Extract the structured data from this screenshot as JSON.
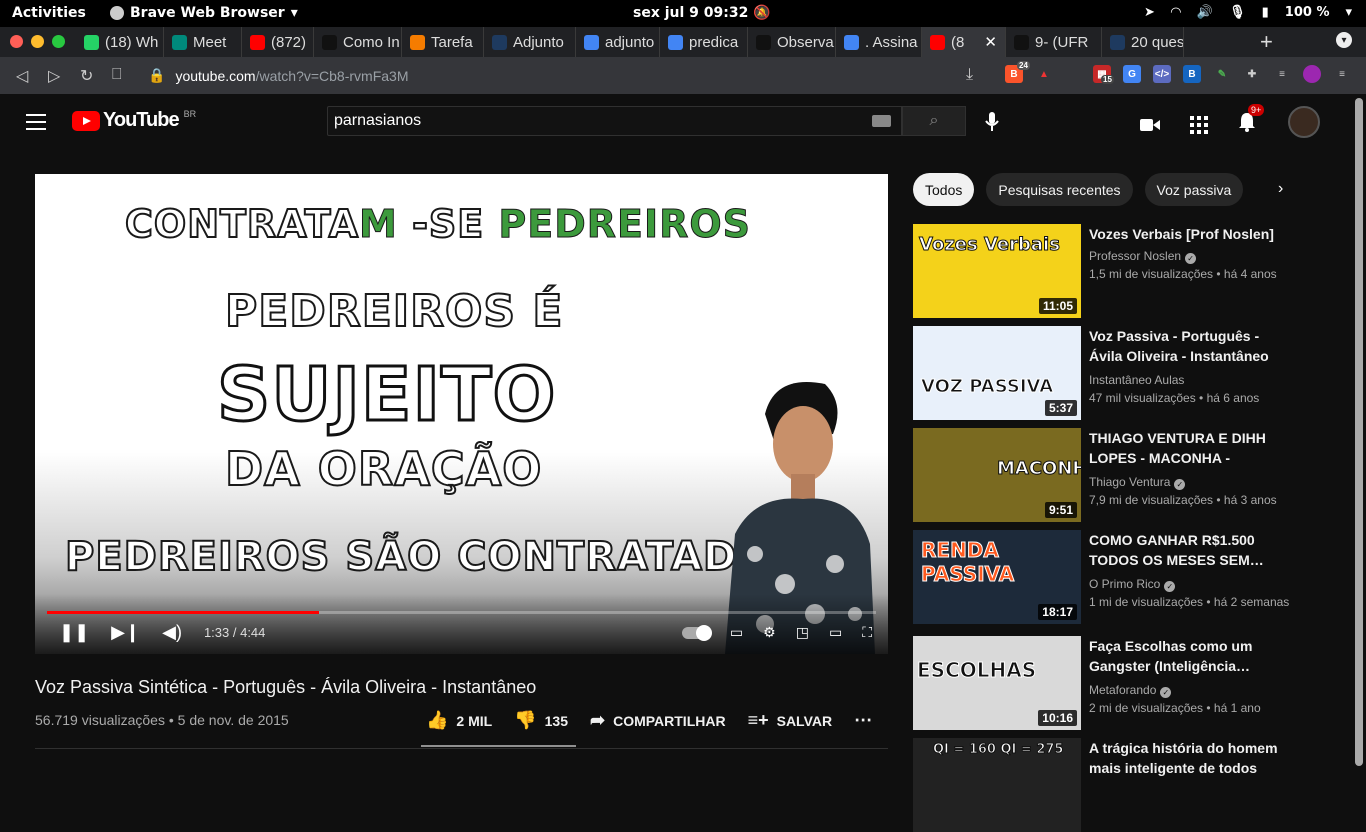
{
  "system": {
    "activities": "Activities",
    "app": "Brave Web Browser",
    "clock": "sex jul 9  09:32",
    "battery": "100 %"
  },
  "tabs": [
    {
      "label": "(18) Wh",
      "color": "#25d366",
      "icon": "whatsapp-icon"
    },
    {
      "label": "Meet",
      "color": "#00897b",
      "icon": "meet-icon"
    },
    {
      "label": "(872)",
      "color": "#ff0000",
      "icon": "youtube-icon"
    },
    {
      "label": "Como In",
      "color": "#111111",
      "icon": "m-icon"
    },
    {
      "label": "Tarefa",
      "color": "#f57c00",
      "icon": "brainly-icon"
    },
    {
      "label": "Adjunto",
      "color": "#1e3a5f",
      "icon": "site-icon"
    },
    {
      "label": "adjunto",
      "color": "#4285f4",
      "icon": "google-icon"
    },
    {
      "label": "predica",
      "color": "#4285f4",
      "icon": "google-icon"
    },
    {
      "label": "Observa",
      "color": "#111111",
      "icon": "b-icon"
    },
    {
      "label": ". Assina",
      "color": "#4285f4",
      "icon": "google-icon"
    },
    {
      "label": "(8",
      "color": "#ff0000",
      "icon": "youtube-icon"
    },
    {
      "label": "9- (UFR",
      "color": "#111111",
      "icon": "b-icon"
    },
    {
      "label": "20 ques",
      "color": "#1e3a5f",
      "icon": "site-icon"
    }
  ],
  "address": {
    "domain": "youtube.com",
    "path": "/watch?v=Cb8-rvmFa3M"
  },
  "extensions": {
    "brave_count": "24",
    "ext_count": "15"
  },
  "header": {
    "logo": "YouTube",
    "country": "BR",
    "search_value": "parnasianos",
    "notifications": "9+"
  },
  "video": {
    "line1a": "CONTRATA",
    "line1b": "M",
    "line1c": " -SE ",
    "line1d": "PEDREIROS",
    ".": ".",
    "line2": "PEDREIROS É",
    "line3": "SUJEITO",
    "line4": "DA ORAÇÃO",
    "line5": "PEDREIROS SÃO CONTRATADOS.",
    "time": "1:33 / 4:44",
    "progress": 0.328
  },
  "info": {
    "title": "Voz Passiva Sintética - Português - Ávila Oliveira - Instantâneo",
    "views": "56.719 visualizações • 5 de nov. de 2015",
    "likes": "2 MIL",
    "dislikes": "135",
    "share": "COMPARTILHAR",
    "save": "SALVAR"
  },
  "chips": [
    "Todos",
    "Pesquisas recentes",
    "Voz passiva"
  ],
  "recs": [
    {
      "title": "Vozes Verbais [Prof Noslen]",
      "channel": "Professor Noslen",
      "meta": "1,5 mi de visualizações • há 4 anos",
      "duration": "11:05",
      "verified": true,
      "thumb_text": "Vozes Verbais"
    },
    {
      "title": "Voz Passiva - Português - Ávila Oliveira - Instantâneo",
      "channel": "Instantâneo Aulas",
      "meta": "47 mil visualizações • há 6 anos",
      "duration": "5:37",
      "verified": false,
      "thumb_text": "VOZ PASSIVA"
    },
    {
      "title": "THIAGO VENTURA E DIHH LOPES - MACONHA - STAND…",
      "channel": "Thiago Ventura",
      "meta": "7,9 mi de visualizações • há 3 anos",
      "duration": "9:51",
      "verified": true,
      "thumb_text": "MACONHA"
    },
    {
      "title": "COMO GANHAR R$1.500 TODOS OS MESES SEM…",
      "channel": "O Primo Rico",
      "meta": "1 mi de visualizações • há 2 semanas",
      "duration": "18:17",
      "verified": true,
      "thumb_text": "RENDA PASSIVA"
    },
    {
      "title": "Faça Escolhas como um Gangster (Inteligência…",
      "channel": "Metaforando",
      "meta": "2 mi de visualizações • há 1 ano",
      "duration": "10:16",
      "verified": true,
      "thumb_text": "ESCOLHAS"
    },
    {
      "title": "A trágica história do homem mais inteligente de todos os…",
      "channel": "",
      "meta": "",
      "duration": "",
      "verified": false,
      "thumb_text": "QI = 160   QI = 275"
    }
  ]
}
